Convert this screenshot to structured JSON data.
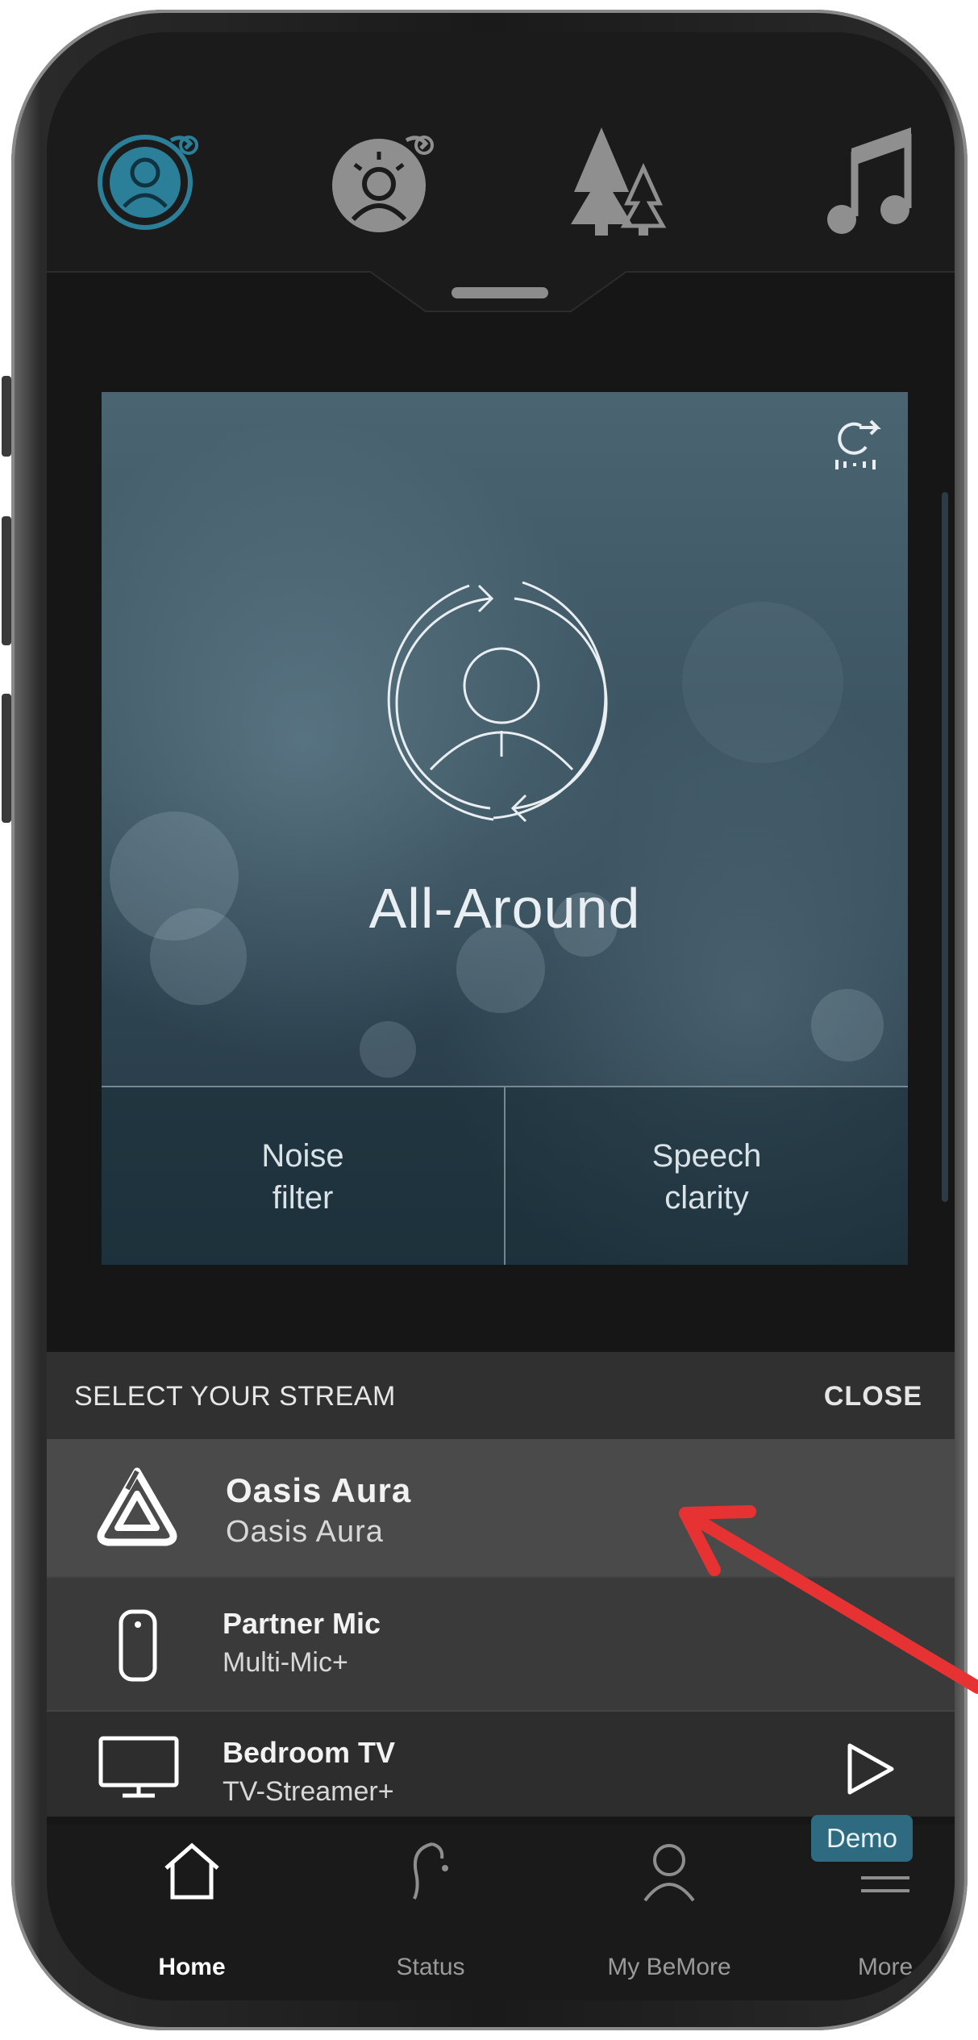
{
  "mode_bar": {
    "icons": [
      "all-around-active-icon",
      "sound-settings-icon",
      "outdoor-trees-icon",
      "music-note-icon"
    ],
    "accent": "#2b7f99"
  },
  "program": {
    "name": "All-Around",
    "options": [
      {
        "label": "Noise\nfilter"
      },
      {
        "label": "Speech\nclarity"
      }
    ]
  },
  "stream_panel": {
    "header": "SELECT YOUR STREAM",
    "close_label": "CLOSE",
    "items": [
      {
        "name": "Oasis Aura",
        "sub": "Oasis Aura",
        "icon": "oasis-aura-logo-icon",
        "selected": true
      },
      {
        "name": "Partner Mic",
        "sub": "Multi-Mic+",
        "icon": "partner-mic-icon"
      },
      {
        "name": "Bedroom TV",
        "sub": "TV-Streamer+",
        "icon": "tv-icon",
        "action_icon": "play-icon"
      }
    ]
  },
  "demo_badge": "Demo",
  "bottom_nav": [
    {
      "label": "Home",
      "icon": "home-icon",
      "active": true
    },
    {
      "label": "Status",
      "icon": "hearing-aid-icon",
      "active": false
    },
    {
      "label": "My BeMore",
      "icon": "person-icon",
      "active": false
    },
    {
      "label": "More",
      "icon": "menu-icon",
      "active": false
    }
  ],
  "colors": {
    "annotation_arrow": "#e63232",
    "demo_badge": "#2e6a80"
  }
}
